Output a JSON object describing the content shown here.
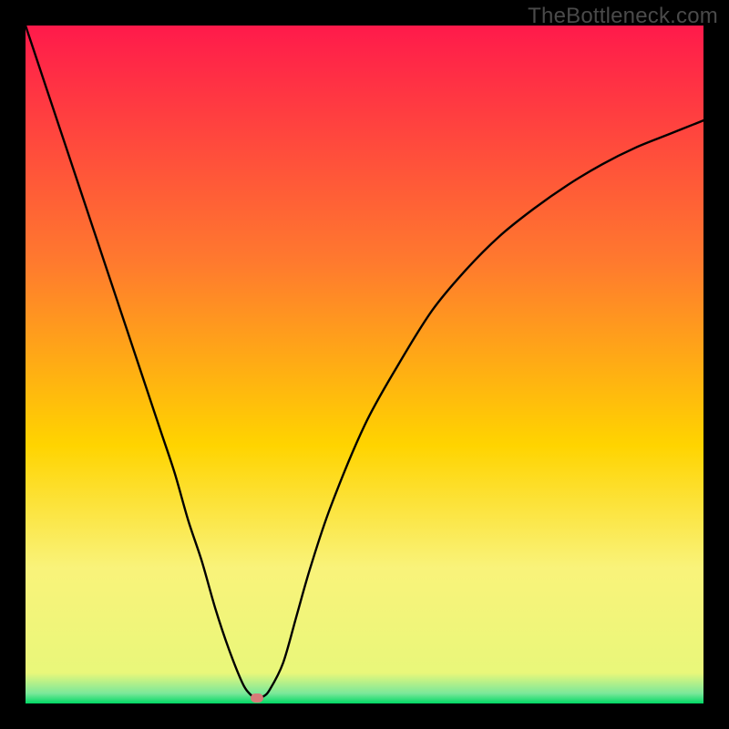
{
  "watermark": "TheBottleneck.com",
  "colors": {
    "frame": "#000000",
    "gradient_top": "#ff1a4b",
    "gradient_mid1": "#ff6a2e",
    "gradient_mid2": "#ffd400",
    "gradient_mid3": "#f9f37a",
    "gradient_bottom": "#00e06a",
    "curve": "#000000",
    "marker": "#d77b79"
  },
  "chart_data": {
    "type": "line",
    "title": "",
    "xlabel": "",
    "ylabel": "",
    "xlim": [
      0,
      100
    ],
    "ylim": [
      0,
      100
    ],
    "series": [
      {
        "name": "bottleneck-curve",
        "x": [
          0,
          2,
          4,
          6,
          8,
          10,
          12,
          14,
          16,
          18,
          20,
          22,
          24,
          26,
          28,
          30,
          32,
          33,
          34,
          35,
          36,
          38,
          40,
          42,
          45,
          50,
          55,
          60,
          65,
          70,
          75,
          80,
          85,
          90,
          95,
          100
        ],
        "y": [
          100,
          94,
          88,
          82,
          76,
          70,
          64,
          58,
          52,
          46,
          40,
          34,
          27,
          21,
          14,
          8,
          3,
          1.5,
          0.8,
          1.0,
          2.0,
          6,
          13,
          20,
          29,
          41,
          50,
          58,
          64,
          69,
          73,
          76.5,
          79.5,
          82,
          84,
          86
        ]
      }
    ],
    "marker": {
      "x": 34.2,
      "y": 0.8,
      "name": "optimal-point"
    },
    "gradient_stops": [
      {
        "offset": 0,
        "color": "#ff1a4b"
      },
      {
        "offset": 0.35,
        "color": "#ff7a2e"
      },
      {
        "offset": 0.62,
        "color": "#ffd400"
      },
      {
        "offset": 0.8,
        "color": "#f9f37a"
      },
      {
        "offset": 0.955,
        "color": "#e9f77a"
      },
      {
        "offset": 0.985,
        "color": "#7be89a"
      },
      {
        "offset": 1.0,
        "color": "#00d865"
      }
    ]
  }
}
